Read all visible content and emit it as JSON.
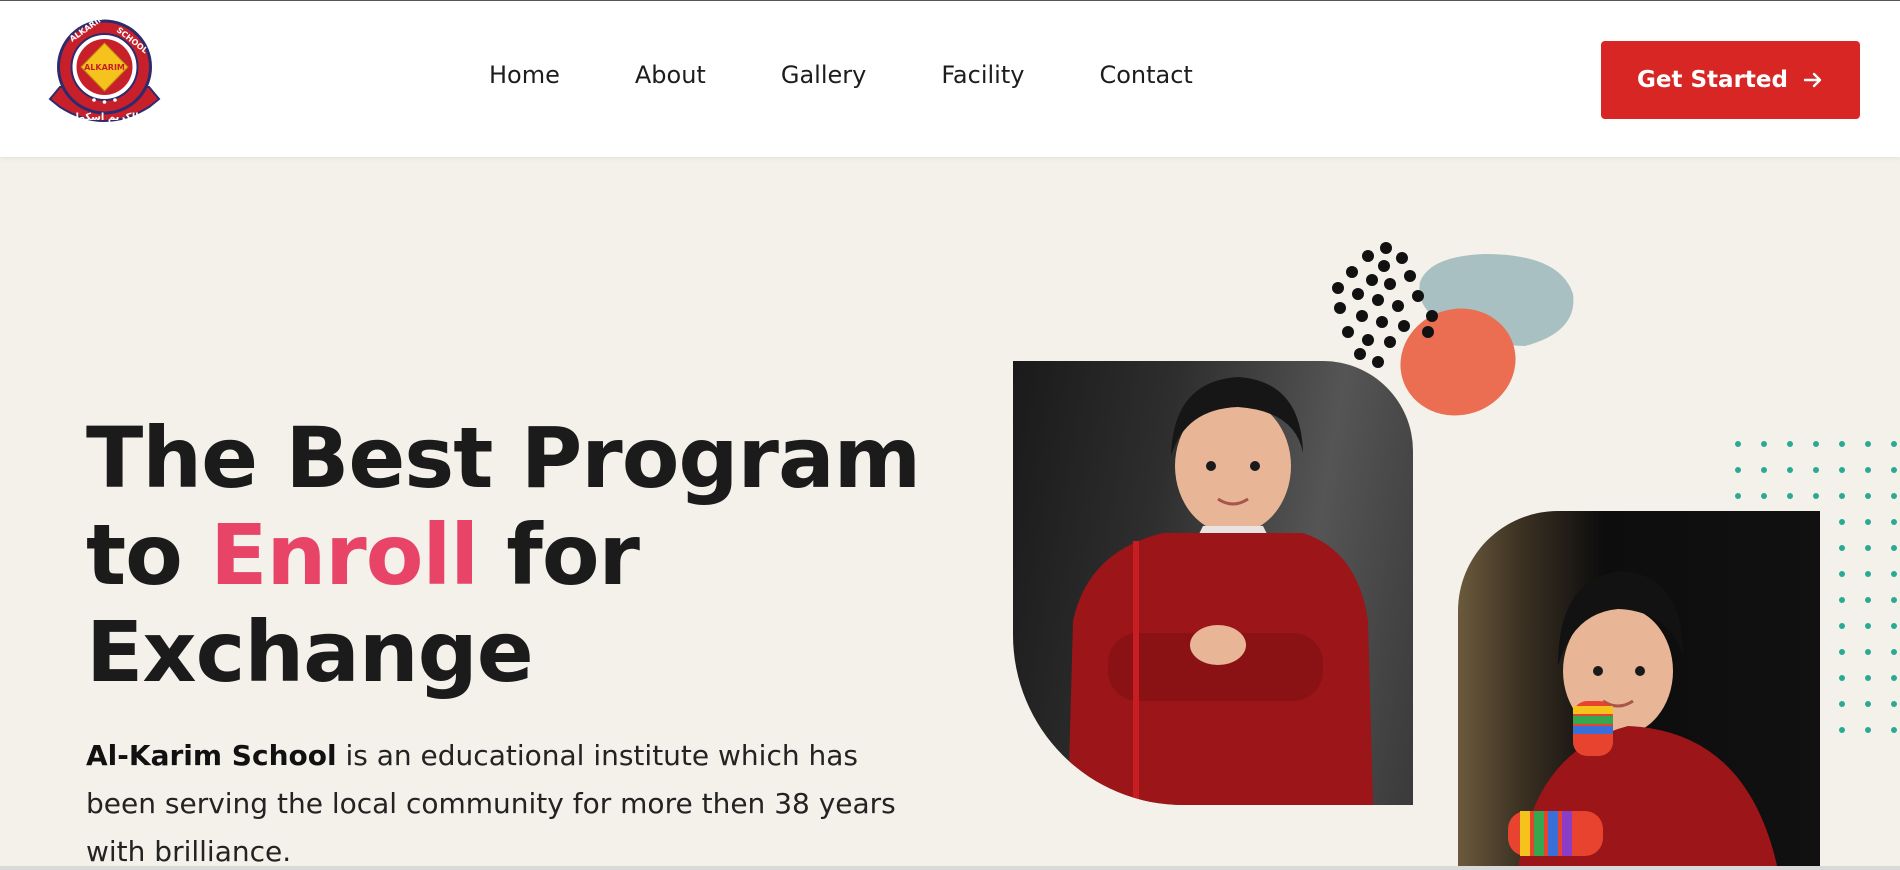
{
  "header": {
    "logo": {
      "ring_text": "ALKARIM • SCHOOL",
      "center_text": "ALKARIM",
      "banner_text": "الکریم اسکول"
    },
    "nav": [
      {
        "label": "Home"
      },
      {
        "label": "About"
      },
      {
        "label": "Gallery"
      },
      {
        "label": "Facility"
      },
      {
        "label": "Contact"
      }
    ],
    "cta_label": "Get Started",
    "cta_icon": "arrow-right-icon"
  },
  "hero": {
    "headline_line1": "The Best Program",
    "headline_to": "to",
    "headline_accent": "Enroll",
    "headline_for": "for",
    "headline_line3": "Exchange",
    "desc_bold": "Al-Karim School",
    "desc_rest": " is an educational institute which has been serving the local community for more then 38 years with brilliance."
  },
  "colors": {
    "brand_red": "#d72624",
    "accent_pink": "#e84468",
    "page_bg": "#f4f0ea",
    "teal_dots": "#2aaa93",
    "coral_blob": "#ec6e52",
    "grey_blob": "#a8c0c1"
  }
}
